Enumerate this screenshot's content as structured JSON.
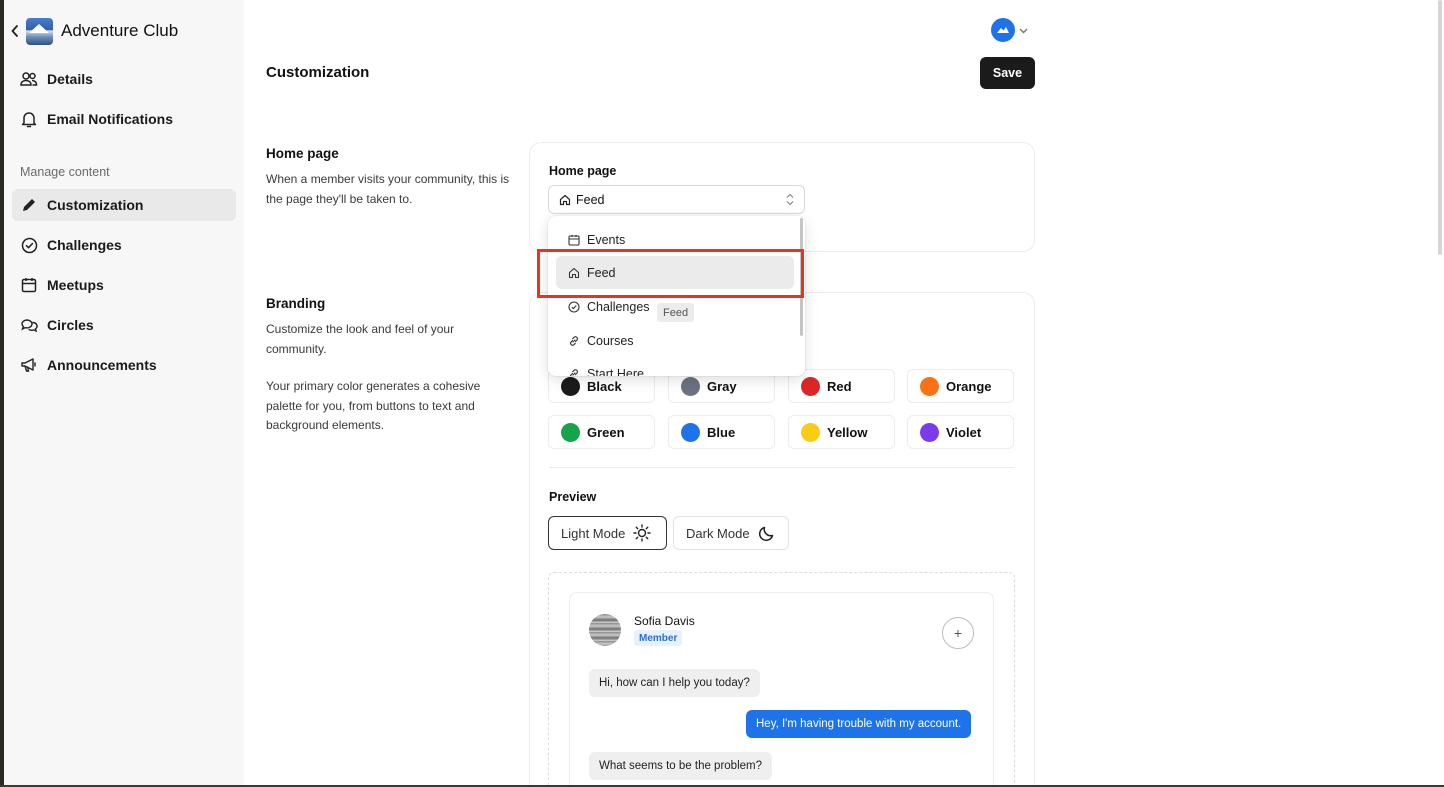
{
  "sidebar": {
    "app_title": "Adventure Club",
    "items_top": [
      {
        "label": "Details",
        "icon": "users-icon"
      },
      {
        "label": "Email Notifications",
        "icon": "bell-icon"
      }
    ],
    "section_label": "Manage content",
    "items_content": [
      {
        "label": "Customization",
        "icon": "pencil-icon",
        "active": true
      },
      {
        "label": "Challenges",
        "icon": "check-circle-icon"
      },
      {
        "label": "Meetups",
        "icon": "calendar-icon"
      },
      {
        "label": "Circles",
        "icon": "chat-bubbles-icon"
      },
      {
        "label": "Announcements",
        "icon": "megaphone-icon"
      }
    ]
  },
  "header": {
    "title": "Customization",
    "save_label": "Save"
  },
  "home_page_section": {
    "title": "Home page",
    "description": "When a member visits your community, this is the page they'll be taken to.",
    "field_label": "Home page",
    "selected_value": "Feed"
  },
  "dropdown": {
    "options": [
      {
        "label": "Events",
        "icon": "calendar-icon"
      },
      {
        "label": "Feed",
        "icon": "home-icon",
        "highlighted": true
      },
      {
        "label": "Challenges",
        "icon": "check-circle-icon"
      },
      {
        "label": "Courses",
        "icon": "link-icon"
      },
      {
        "label": "Start Here",
        "icon": "link-icon"
      }
    ],
    "tooltip": "Feed"
  },
  "branding_section": {
    "title": "Branding",
    "description_1": "Customize the look and feel of your community.",
    "description_2": "Your primary color generates a cohesive palette for you, from buttons to text and background elements.",
    "colors": [
      {
        "label": "Black",
        "hex": "#1b1b1b"
      },
      {
        "label": "Gray",
        "hex": "#6b7280"
      },
      {
        "label": "Red",
        "hex": "#dc2626"
      },
      {
        "label": "Orange",
        "hex": "#f97316"
      },
      {
        "label": "Green",
        "hex": "#16a34a"
      },
      {
        "label": "Blue",
        "hex": "#1e73e8"
      },
      {
        "label": "Yellow",
        "hex": "#facc15"
      },
      {
        "label": "Violet",
        "hex": "#7c3aed"
      }
    ]
  },
  "preview": {
    "label": "Preview",
    "light_mode_label": "Light Mode",
    "dark_mode_label": "Dark Mode",
    "chat": {
      "user_name": "Sofia Davis",
      "badge": "Member",
      "plus": "+",
      "messages": [
        {
          "text": "Hi, how can I help you today?",
          "from": "them"
        },
        {
          "text": "Hey, I'm having trouble with my account.",
          "from": "me"
        },
        {
          "text": "What seems to be the problem?",
          "from": "them"
        }
      ]
    }
  }
}
